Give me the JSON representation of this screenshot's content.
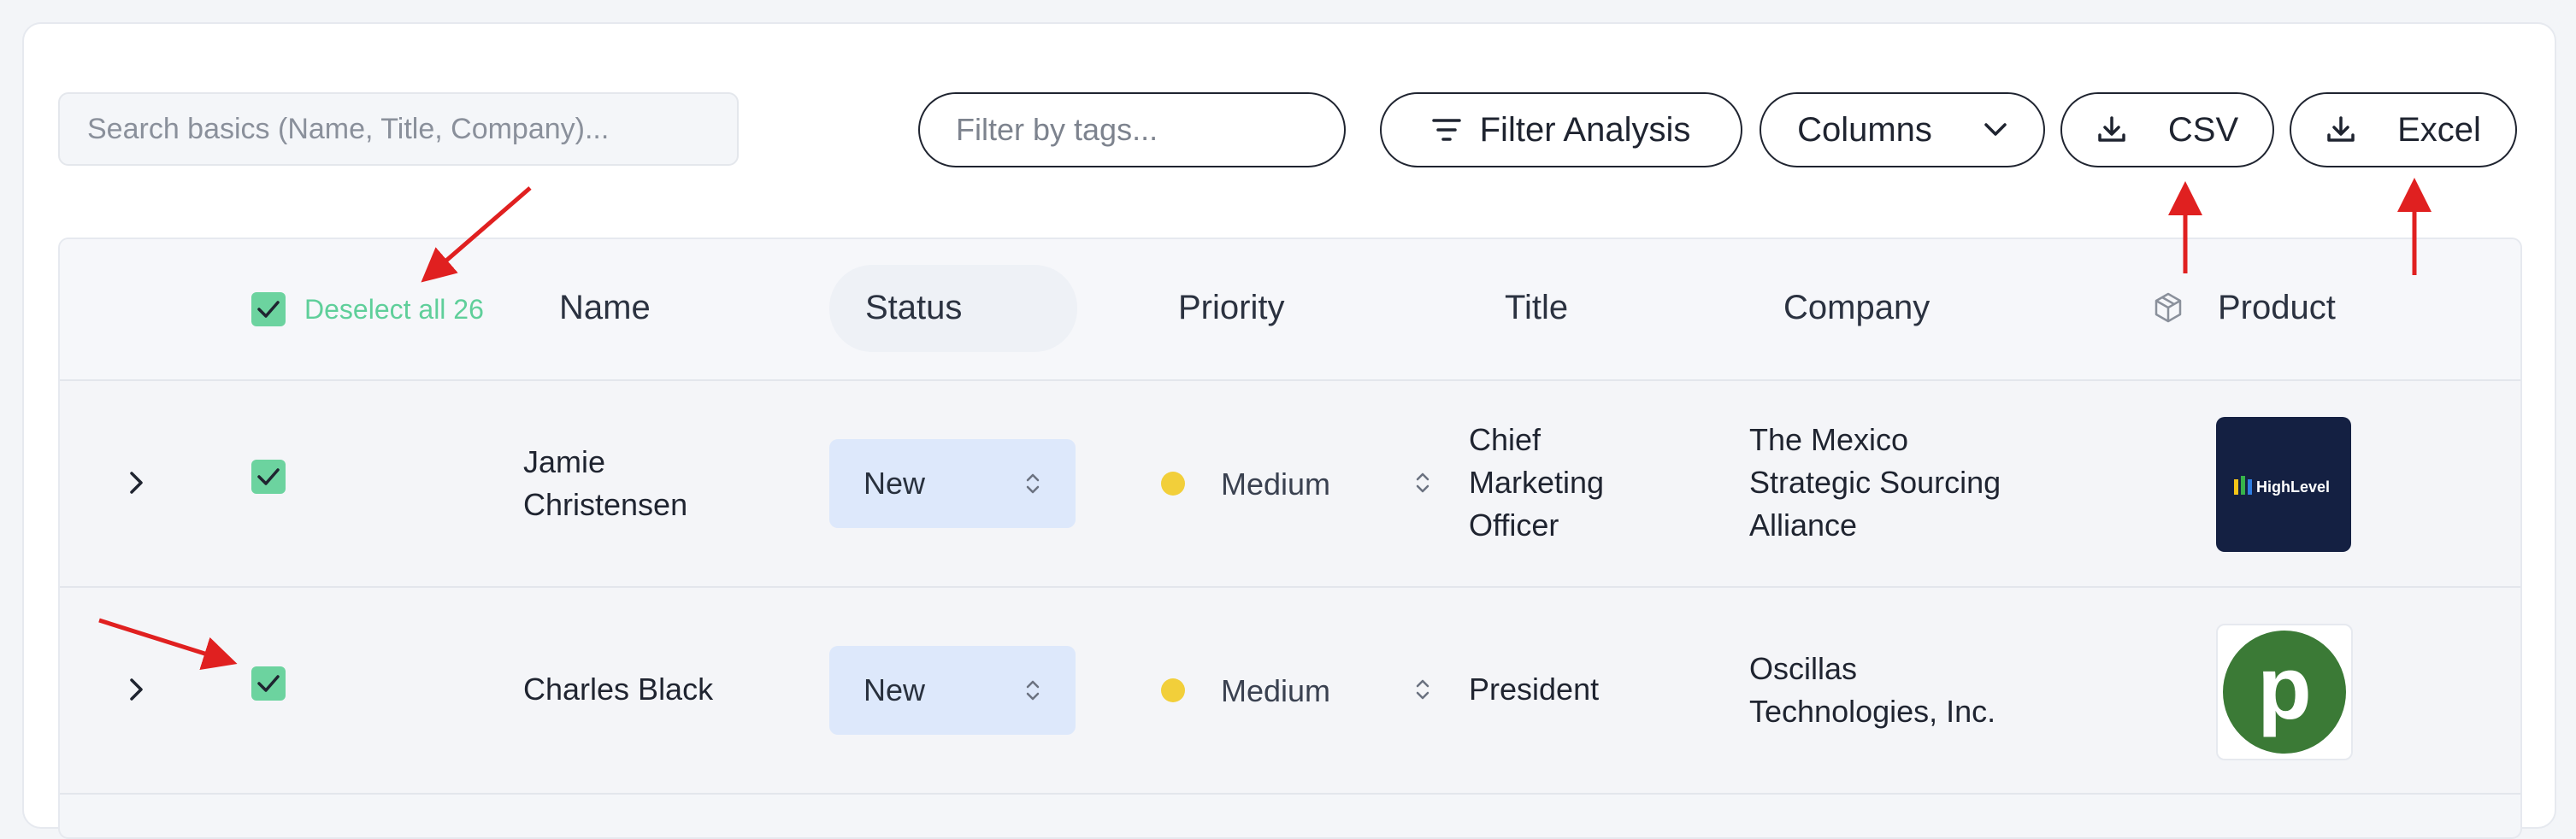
{
  "toolbar": {
    "search_placeholder": "Search basics (Name, Title, Company)...",
    "tags_placeholder": "Filter by tags...",
    "filter_label": "Filter Analysis",
    "columns_label": "Columns",
    "csv_label": "CSV",
    "excel_label": "Excel"
  },
  "table": {
    "select_all_label": "Deselect all 26",
    "headers": {
      "name": "Name",
      "status": "Status",
      "priority": "Priority",
      "title": "Title",
      "company": "Company",
      "product": "Product"
    },
    "rows": [
      {
        "name_line1": "Jamie",
        "name_line2": "Christensen",
        "status": "New",
        "priority": "Medium",
        "title_line1": "Chief",
        "title_line2": "Marketing",
        "title_line3": "Officer",
        "company_line1": "The Mexico",
        "company_line2": "Strategic Sourcing",
        "company_line3": "Alliance",
        "product_logo": "HighLevel",
        "selected": true
      },
      {
        "name": "Charles Black",
        "status": "New",
        "priority": "Medium",
        "title": "President",
        "company_line1": "Oscillas",
        "company_line2": "Technologies, Inc.",
        "product_logo": "p",
        "selected": true
      }
    ]
  },
  "colors": {
    "checkbox": "#6cd39f",
    "status_pill": "#dde8fb",
    "priority_medium": "#f2cf3a",
    "annotation_arrow": "#e02020",
    "logo_highlevel_bg": "#142042",
    "logo_p_green": "#3b7a36"
  },
  "icons": [
    "filter-icon",
    "chevron-down-icon",
    "download-icon",
    "checkmark-icon",
    "chevron-right-icon",
    "sort-icon",
    "cube-icon"
  ]
}
